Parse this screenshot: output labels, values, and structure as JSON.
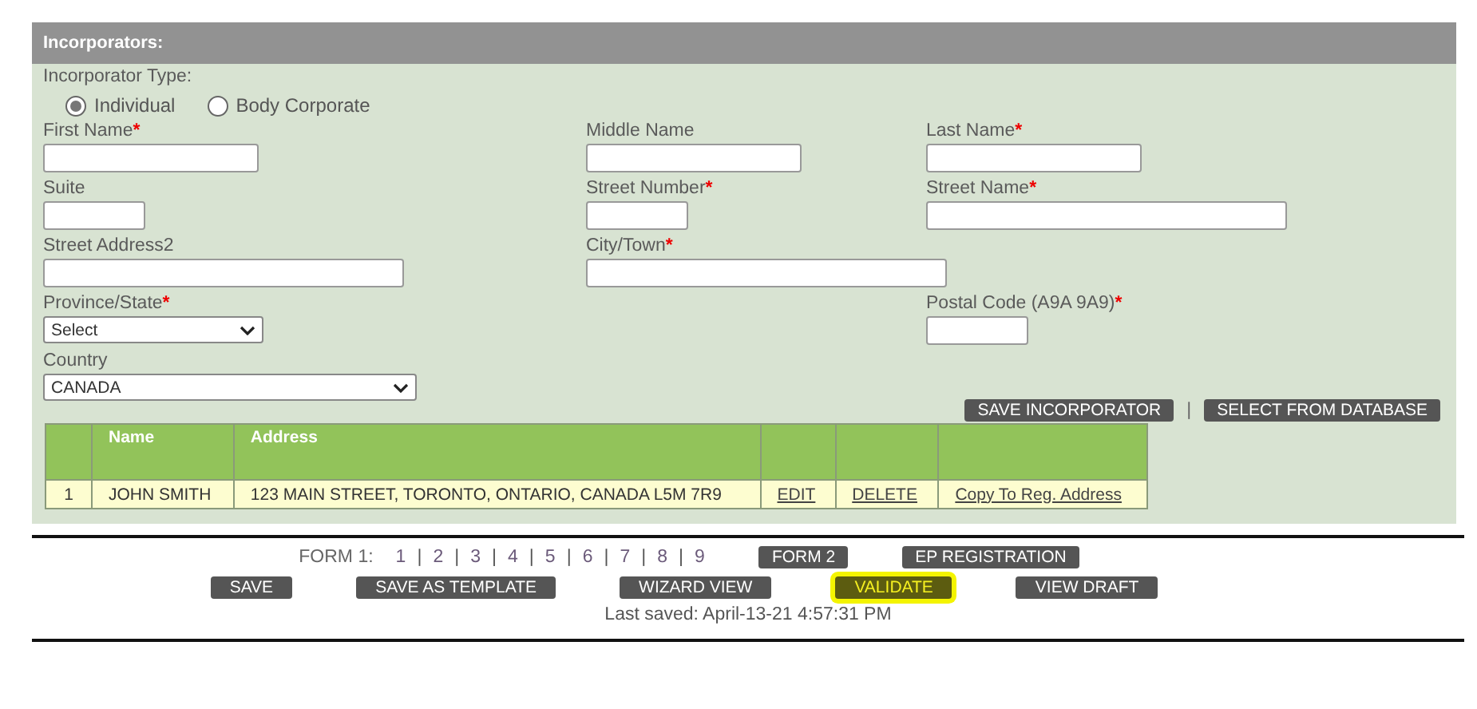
{
  "section": {
    "title": "Incorporators:"
  },
  "incorporator_type": {
    "label": "Incorporator Type:",
    "options": [
      {
        "label": "Individual",
        "selected": true
      },
      {
        "label": "Body Corporate",
        "selected": false
      }
    ]
  },
  "field_rows": [
    [
      {
        "label": "First Name",
        "required_mark": "*",
        "kind": "text"
      },
      {
        "label": "Middle Name",
        "kind": "text"
      },
      {
        "label": "Last Name",
        "required_mark": "*",
        "kind": "text"
      }
    ],
    [
      {
        "label": "Suite",
        "kind": "text"
      },
      {
        "label": "Street Number",
        "required_mark": "*",
        "kind": "text"
      },
      {
        "label": "Street Name",
        "required_mark": "*",
        "kind": "text"
      }
    ],
    [
      {
        "label": "Street Address2",
        "kind": "text"
      },
      {
        "label": "City/Town",
        "required_mark": "*",
        "kind": "text"
      },
      null
    ],
    [
      {
        "label": "Province/State",
        "required_mark": "*",
        "kind": "select",
        "value": "Select"
      },
      null,
      {
        "label": "Postal Code (A9A 9A9)",
        "required_mark": "*",
        "kind": "text"
      }
    ],
    [
      {
        "label": "Country",
        "kind": "select",
        "value": "CANADA"
      },
      null,
      null
    ]
  ],
  "incorporator_actions": [
    "SAVE INCORPORATOR",
    "SELECT FROM DATABASE"
  ],
  "incorporator_actions_separator": "|",
  "table": {
    "columns": [
      "Name",
      "Address"
    ],
    "rows": [
      {
        "number": "1",
        "name": "JOHN SMITH",
        "address": "123 MAIN STREET, TORONTO, ONTARIO, CANADA L5M 7R9",
        "links": [
          "EDIT",
          "DELETE",
          "Copy To Reg. Address"
        ]
      }
    ]
  },
  "form_nav": {
    "label": "FORM 1:",
    "separator": "|",
    "pages": [
      "1",
      "2",
      "3",
      "4",
      "5",
      "6",
      "7",
      "8",
      "9"
    ],
    "buttons": [
      "FORM 2",
      "EP REGISTRATION"
    ]
  },
  "actions": [
    {
      "label": "SAVE",
      "highlighted": false
    },
    {
      "label": "SAVE AS TEMPLATE",
      "highlighted": false
    },
    {
      "label": "WIZARD VIEW",
      "highlighted": false
    },
    {
      "label": "VALIDATE",
      "highlighted": true
    },
    {
      "label": "VIEW DRAFT",
      "highlighted": false
    }
  ],
  "last_saved": "Last saved: April-13-21 4:57:31 PM"
}
